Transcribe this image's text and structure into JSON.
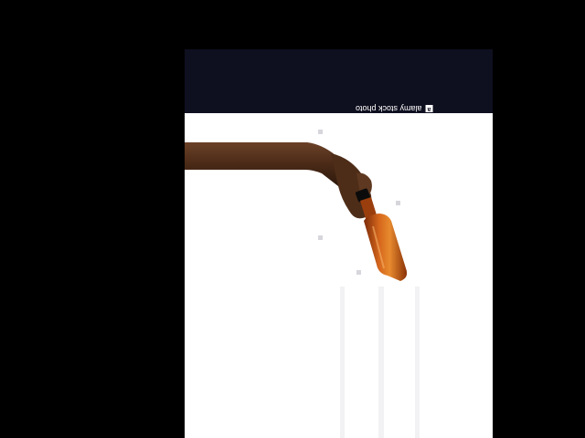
{
  "watermark": {
    "brand_text": "alamy stock photo",
    "brand_mark": "a"
  },
  "colors": {
    "background": "#000000",
    "photo_background": "#ffffff",
    "banner": "#0e0f1f",
    "skin": "#5a3520",
    "bottle": "#c8561a"
  },
  "icons": {
    "brand_mark": "alamy-logo-icon"
  }
}
